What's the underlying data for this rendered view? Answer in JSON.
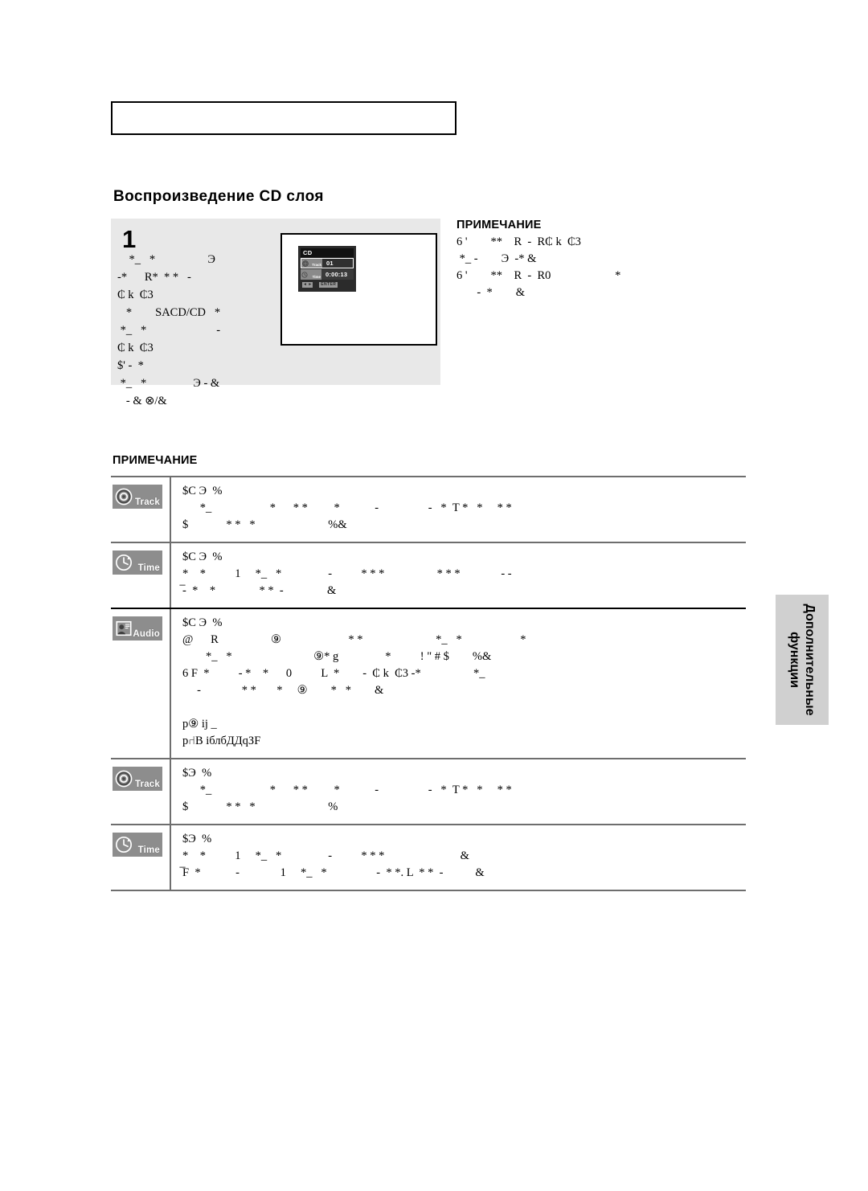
{
  "page": {
    "language": "ru",
    "top_box_text": ""
  },
  "section": {
    "heading": "Воспроизведение CD слоя"
  },
  "step": {
    "number": "1",
    "body_lines": "    *_   *                  Э\n-*      R*  * *   -\n₵ k  ₵3\n   *        SACD/CD   *\n *_   *                        -\n₵ k  ₵3\n$' -  *\n *_   *                Э - &\n   - & ⊗/&"
  },
  "tv": {
    "osd": {
      "title": "CD",
      "rows": [
        {
          "icon": "disc-icon",
          "label": "Track",
          "value": "01",
          "selected": true
        },
        {
          "icon": "clock-icon",
          "label": "Time",
          "value": "0:00:13",
          "selected": false
        }
      ],
      "footer": {
        "nav_keys": "◄ ►",
        "enter_label": "ENTER",
        "enter_marker": "■"
      }
    }
  },
  "note_right": {
    "title": "ПРИМЕЧАНИЕ",
    "body": "6 '        **    R  -  R₵ k  ₵3\n *_ -        Э  -* &\n6 '        **    R  -  R0                      *\n       -  *        &"
  },
  "note_lower": {
    "title": "ПРИМЕЧАНИЕ"
  },
  "table": {
    "rows": [
      {
        "badge": {
          "icon": "disc-icon",
          "label": "Track"
        },
        "text": "$C Э  %\n      *_                    *      * *         *            -                 -   *  T *   *     * *\n$             * *   *                         %&",
        "divider": "gray"
      },
      {
        "badge": {
          "icon": "clock-icon",
          "label": "Time"
        },
        "text": "$C Э  %\n*    *          1     *_   *                -          * * *                  * * *              - -\n̅-  *    *               * *  -               &",
        "divider": "black"
      },
      {
        "badge": {
          "icon": "audio-icon",
          "label": "Audio"
        },
        "text": "$C Э  %\n@      R                  ⑨                       * *                         *_   *                    *\n        *_   *                            ⑨* g                *          ! \" # $        %&\n6 F  *          - *    *      0          L  *        -  ₵ k  ₵3 -*                  *_\n     -              * *       *     ⑨        *   *        &\n\nр⑨ ij _\nр⑁В iблбДДqЗF",
        "divider": "gray"
      },
      {
        "badge": {
          "icon": "disc-icon",
          "label": "Track"
        },
        "text": "$Э  %\n      *_                    *      * *         *            -                 -   *  T *   *     * *\n$             * *   *                         %",
        "divider": "gray"
      },
      {
        "badge": {
          "icon": "clock-icon",
          "label": "Time"
        },
        "text": "$Э  %\n*    *          1     *_   *                -          * * *                          &\n̅F  *            -              1     *_   *                 -  * *. L  * *  -           &",
        "divider": "gray"
      }
    ]
  },
  "side_tab": {
    "line1": "Дополнительные",
    "line2": "функции"
  },
  "colors": {
    "panel_gray": "#e8e8e8",
    "chip_gray": "#8d8d8d",
    "rule_gray": "#6e6e6e",
    "tab_gray": "#d0d0d0",
    "osd_dark": "#2b2b2b"
  }
}
